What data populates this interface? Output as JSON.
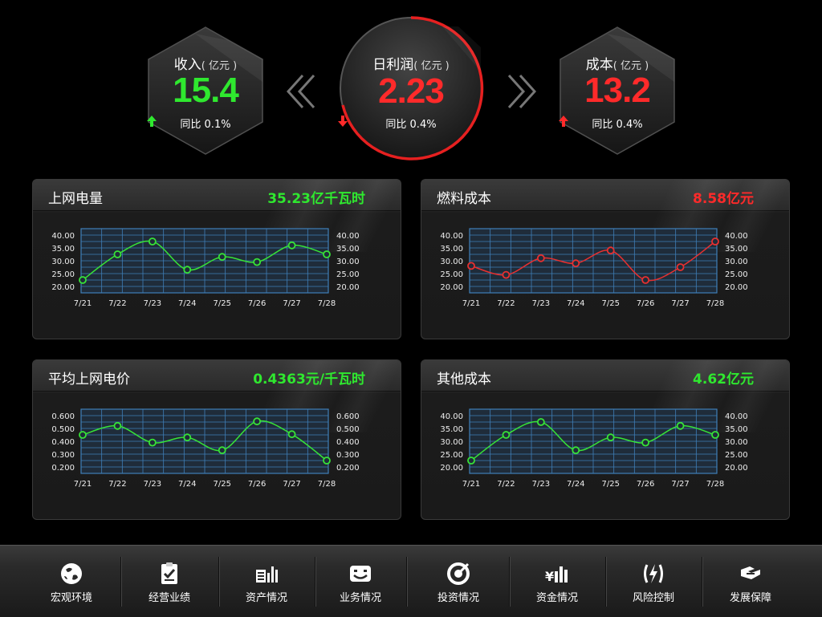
{
  "kpis": {
    "left": {
      "title": "收入",
      "unit": "( 亿元 )",
      "value": "15.4",
      "sub": "同比 0.1%",
      "trend": "up",
      "color": "#2fe82f",
      "arrow_color": "#2fe82f"
    },
    "center": {
      "title": "日利润",
      "unit": "( 亿元 )",
      "value": "2.23",
      "sub": "同比 0.4%",
      "trend": "down",
      "color": "#ff2a2a",
      "arrow_color": "#ff2a2a"
    },
    "right": {
      "title": "成本",
      "unit": "( 亿元 )",
      "value": "13.2",
      "sub": "同比 0.4%",
      "trend": "up",
      "color": "#ff2a2a",
      "arrow_color": "#ff2a2a"
    }
  },
  "panels": [
    {
      "title": "上网电量",
      "value": "35.23亿千瓦时",
      "value_color": "#2fe82f"
    },
    {
      "title": "燃料成本",
      "value": "8.58亿元",
      "value_color": "#ff2a2a"
    },
    {
      "title": "平均上网电价",
      "value": "0.4363元/千瓦时",
      "value_color": "#2fe82f"
    },
    {
      "title": "其他成本",
      "value": "4.62亿元",
      "value_color": "#2fe82f"
    }
  ],
  "chart_data": [
    {
      "type": "line",
      "title": "上网电量",
      "categories": [
        "7/21",
        "7/22",
        "7/23",
        "7/24",
        "7/25",
        "7/26",
        "7/27",
        "7/28"
      ],
      "values": [
        22.5,
        32.5,
        37.5,
        26.5,
        31.5,
        29.5,
        36.0,
        32.5
      ],
      "ylim": [
        20,
        40
      ],
      "yticks": [
        "40.00",
        "35.00",
        "30.00",
        "25.00",
        "20.00"
      ],
      "color": "#37e337",
      "grid": true
    },
    {
      "type": "line",
      "title": "燃料成本",
      "categories": [
        "7/21",
        "7/22",
        "7/23",
        "7/24",
        "7/25",
        "7/26",
        "7/27",
        "7/28"
      ],
      "values": [
        28.0,
        24.5,
        31.0,
        29.0,
        34.0,
        22.5,
        27.5,
        37.5
      ],
      "ylim": [
        20,
        40
      ],
      "yticks": [
        "40.00",
        "35.00",
        "30.00",
        "25.00",
        "20.00"
      ],
      "color": "#e83030",
      "grid": true
    },
    {
      "type": "line",
      "title": "平均上网电价",
      "categories": [
        "7/21",
        "7/22",
        "7/23",
        "7/24",
        "7/25",
        "7/26",
        "7/27",
        "7/28"
      ],
      "values": [
        0.45,
        0.52,
        0.39,
        0.43,
        0.33,
        0.555,
        0.455,
        0.25
      ],
      "ylim": [
        0.2,
        0.6
      ],
      "yticks": [
        "0.600",
        "0.500",
        "0.400",
        "0.300",
        "0.200"
      ],
      "color": "#37e337",
      "grid": true
    },
    {
      "type": "line",
      "title": "其他成本",
      "categories": [
        "7/21",
        "7/22",
        "7/23",
        "7/24",
        "7/25",
        "7/26",
        "7/27",
        "7/28"
      ],
      "values": [
        22.5,
        32.5,
        37.5,
        26.5,
        31.5,
        29.5,
        36.0,
        32.5
      ],
      "ylim": [
        20,
        40
      ],
      "yticks": [
        "40.00",
        "35.00",
        "30.00",
        "25.00",
        "20.00"
      ],
      "color": "#37e337",
      "grid": true
    }
  ],
  "nav": [
    {
      "label": "宏观环境",
      "icon": "globe-icon"
    },
    {
      "label": "经营业绩",
      "icon": "clipboard-check-icon"
    },
    {
      "label": "资产情况",
      "icon": "bar-chart-icon"
    },
    {
      "label": "业务情况",
      "icon": "smile-box-icon"
    },
    {
      "label": "投资情况",
      "icon": "target-icon"
    },
    {
      "label": "资金情况",
      "icon": "yen-bars-icon"
    },
    {
      "label": "风险控制",
      "icon": "lightning-icon"
    },
    {
      "label": "发展保障",
      "icon": "handshake-icon"
    }
  ]
}
